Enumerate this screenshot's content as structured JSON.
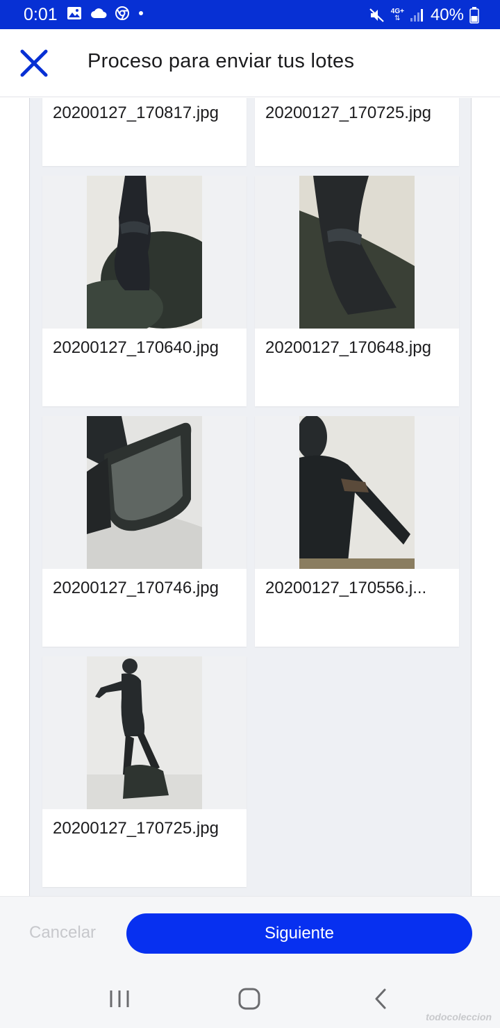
{
  "status_bar": {
    "time": "0:01",
    "network": "4G+",
    "battery": "40%",
    "left_icons": [
      "image-icon",
      "cloud-icon",
      "chrome-icon",
      "dot-icon"
    ],
    "right_icons": [
      "mute-icon",
      "network-icon",
      "signal-icon",
      "battery-icon"
    ]
  },
  "header": {
    "title": "Proceso para enviar tus lotes",
    "close_icon": "close-icon",
    "accent_color": "#0730d4"
  },
  "files": [
    {
      "name": "20200127_170817.jpg"
    },
    {
      "name": "20200127_170725.jpg"
    },
    {
      "name": "20200127_170640.jpg"
    },
    {
      "name": "20200127_170648.jpg"
    },
    {
      "name": "20200127_170746.jpg"
    },
    {
      "name": "20200127_170556.j..."
    },
    {
      "name": "20200127_170725.jpg"
    }
  ],
  "actions": {
    "cancel_label": "Cancelar",
    "next_label": "Siguiente",
    "next_color": "#0730f0"
  },
  "nav": {
    "icons": [
      "recents-icon",
      "home-icon",
      "back-icon"
    ]
  },
  "watermark": "todocoleccion"
}
